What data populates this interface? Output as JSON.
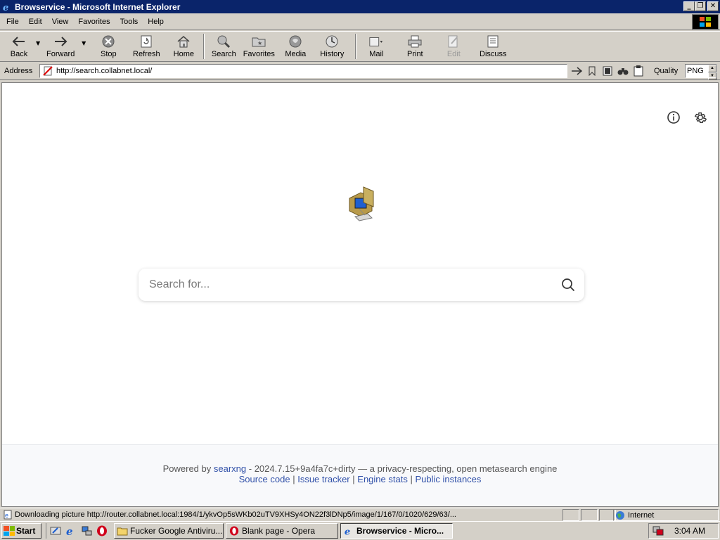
{
  "window": {
    "title": "Browservice - Microsoft Internet Explorer",
    "minimize_glyph": "_",
    "maximize_glyph": "❐",
    "close_glyph": "✕"
  },
  "menu": [
    "File",
    "Edit",
    "View",
    "Favorites",
    "Tools",
    "Help"
  ],
  "toolbar": {
    "back": "Back",
    "forward": "Forward",
    "stop": "Stop",
    "refresh": "Refresh",
    "home": "Home",
    "search": "Search",
    "favorites": "Favorites",
    "media": "Media",
    "history": "History",
    "mail": "Mail",
    "print": "Print",
    "edit": "Edit",
    "discuss": "Discuss"
  },
  "address": {
    "label": "Address",
    "url": "http://search.collabnet.local/",
    "quality_label": "Quality",
    "quality_value": "PNG"
  },
  "page": {
    "search_placeholder": "Search for...",
    "footer": {
      "powered_by": "Powered by",
      "engine_name": "searxng",
      "version_text": "- 2024.7.15+9a4fa7c+dirty — a privacy-respecting, open metasearch engine",
      "links": [
        "Source code",
        "Issue tracker",
        "Engine stats",
        "Public instances"
      ],
      "separator": "|"
    }
  },
  "status": {
    "text": "Downloading picture http://router.collabnet.local:1984/1/ykvOp5sWKb02uTV9XHSy4ON22f3lDNp5/image/1/167/0/1020/629/63/...",
    "zone": "Internet"
  },
  "taskbar": {
    "start": "Start",
    "tasks": [
      {
        "label": "Fucker Google Antiviru...",
        "active": false
      },
      {
        "label": "Blank page - Opera",
        "active": false
      },
      {
        "label": "Browservice - Micro...",
        "active": true
      }
    ],
    "clock": "3:04 AM"
  },
  "colors": {
    "titlebar": "#0a246a",
    "chrome": "#d4d0c8",
    "link": "#3050a8"
  }
}
